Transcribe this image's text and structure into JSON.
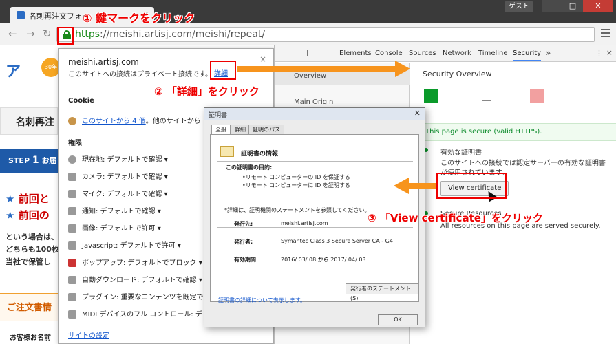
{
  "browser": {
    "tab_title": "名刺再注文フォー",
    "tab_close": "×",
    "user_badge": "ゲスト",
    "win_min": "−",
    "win_max": "□",
    "win_close": "✕",
    "url_scheme": "https",
    "url_rest": "://meishi.artisj.com/meishi/repeat/"
  },
  "page": {
    "logo": "ア",
    "badge": "30年",
    "title": "名刺再注",
    "step_num": "1",
    "step_label": "お届",
    "line1": "前回と",
    "line2": "前回の",
    "text1": "という場合は、",
    "text2": "どちらも100枚",
    "text3": "当社で保管し",
    "order_heading": "ご注文書情",
    "customer_label": "お客様お名前"
  },
  "popup": {
    "host": "meishi.artisj.com",
    "message": "このサイトへの接続はプライベート接続です。",
    "detail_link": "詳細",
    "close": "×",
    "cookie_heading": "Cookie",
    "cookie_link": "このサイトから 4 個",
    "cookie_suffix": "。他のサイトから",
    "permissions_heading": "権限",
    "permissions": [
      "現在地: デフォルトで確認 ▾",
      "カメラ: デフォルトで確認 ▾",
      "マイク: デフォルトで確認 ▾",
      "通知: デフォルトで確認 ▾",
      "画像: デフォルトで許可 ▾",
      "Javascript: デフォルトで許可 ▾",
      "ポップアップ: デフォルトでブロック ▾",
      "自動ダウンロード: デフォルトで確認 ▾",
      "プラグイン: 重要なコンテンツを既定で",
      "MIDI デバイスのフル コントロール: デ"
    ],
    "site_settings": "サイトの設定"
  },
  "devtools": {
    "tabs": [
      "Elements",
      "Console",
      "Sources",
      "Network",
      "Timeline",
      "Security"
    ],
    "more": "»",
    "kebab": "⋮",
    "close": "×",
    "left_items": [
      "Overview",
      "Main Origin"
    ],
    "heading": "Security Overview",
    "secure_msg": "This page is secure (valid HTTPS).",
    "cert_title": "有効な証明書",
    "cert_desc": "このサイトへの接続では認定サーバーの有効な証明書が使用されています。",
    "view_cert": "View certificate",
    "res_title": "Secure Resources",
    "res_desc": "All resources on this page are served securely."
  },
  "cert_dialog": {
    "title": "証明書",
    "close": "✕",
    "tabs": [
      "全般",
      "詳細",
      "証明のパス"
    ],
    "info_heading": "証明書の情報",
    "purpose_heading": "この証明書の目的:",
    "purposes": [
      "•リモート コンピューターの ID を保証する",
      "•リモート コンピューターに ID を証明する"
    ],
    "note": "*詳細は、証明機関のステートメントを参照してください。",
    "issued_to_label": "発行先:",
    "issued_to": "meishi.artisj.com",
    "issuer_label": "発行者:",
    "issuer": "Symantec Class 3 Secure Server CA - G4",
    "valid_label": "有効期間",
    "valid_from": "2016/ 03/ 08",
    "valid_sep": "から",
    "valid_to": "2017/ 04/ 03",
    "statement_btn": "発行者のステートメント(S)",
    "learn_more": "証明書の詳細について表示します。",
    "ok": "OK"
  },
  "annotations": {
    "step1": "① 鍵マークをクリック",
    "step2": "② 「詳細」をクリック",
    "step3": "③ 「View certificate」をクリック",
    "highlight_color": "#e00000",
    "arrow_color": "#f7941d"
  }
}
